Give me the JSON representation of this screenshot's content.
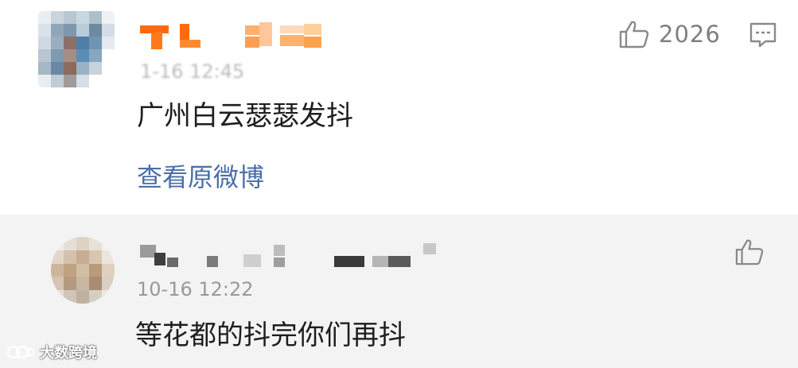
{
  "comments": [
    {
      "time_blurred": "1-16 12:45",
      "text": "广州白云瑟瑟发抖",
      "view_original_label": "查看原微博",
      "like_count": "2026",
      "like_icon": "thumbs-up-icon",
      "reply_icon": "comment-icon"
    },
    {
      "time": "10-16 12:22",
      "text": "等花都的抖完你们再抖",
      "like_icon": "thumbs-up-icon"
    }
  ],
  "watermark": {
    "text": "大数跨境"
  },
  "colors": {
    "link": "#4a6ea8",
    "meta": "#999999",
    "reply_bg": "#f3f3f3",
    "name_orange": "#ff7a1a"
  }
}
